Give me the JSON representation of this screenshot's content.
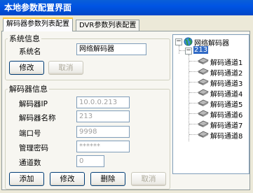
{
  "window": {
    "title": "本地参数配置界面"
  },
  "tabs": [
    {
      "label": "解码器参数列表配置"
    },
    {
      "label": "DVR参数列表配置"
    }
  ],
  "system_group": {
    "legend": "系统信息",
    "name_label": "系统名",
    "name_value": "网络解码器",
    "modify_label": "修改",
    "cancel_label": "取消"
  },
  "decoder_group": {
    "legend": "解码器信息",
    "ip_label": "解码器IP",
    "ip_value": "10.0.0.213",
    "name_label": "解码器名称",
    "name_value": "213",
    "port_label": "端口号",
    "port_value": "9998",
    "password_label": "管理密码",
    "password_value": "******",
    "channels_label": "通道数",
    "channels_value": "0",
    "add_label": "添加",
    "modify_label": "修改",
    "delete_label": "删除",
    "cancel_label": "取消"
  },
  "tree": {
    "root": "网络解码器",
    "decoder": "213",
    "channels": [
      "解码通道1",
      "解码通道2",
      "解码通道3",
      "解码通道4",
      "解码通道5",
      "解码通道6",
      "解码通道7",
      "解码通道8"
    ]
  }
}
